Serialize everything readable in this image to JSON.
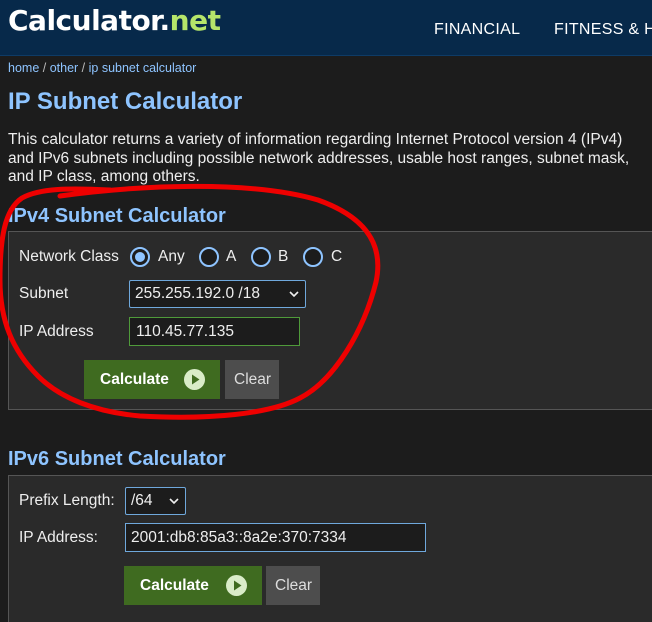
{
  "header": {
    "logo_main": "Calculator",
    "logo_dot": ".",
    "logo_tld": "net",
    "nav": [
      "FINANCIAL",
      "FITNESS & HEALTH"
    ]
  },
  "breadcrumb": {
    "home": "home",
    "sep": " / ",
    "other": "other",
    "current": "ip subnet calculator"
  },
  "page": {
    "title": "IP Subnet Calculator",
    "intro": "This calculator returns a variety of information regarding Internet Protocol version 4 (IPv4) and IPv6 subnets including possible network addresses, usable host ranges, subnet mask, and IP class, among others."
  },
  "ipv4": {
    "title": "IPv4 Subnet Calculator",
    "network_class_label": "Network Class",
    "network_class_options": [
      "Any",
      "A",
      "B",
      "C"
    ],
    "network_class_selected": "Any",
    "subnet_label": "Subnet",
    "subnet_value": "255.255.192.0 /18",
    "ip_label": "IP Address",
    "ip_value": "110.45.77.135",
    "calculate_label": "Calculate",
    "clear_label": "Clear"
  },
  "ipv6": {
    "title": "IPv6 Subnet Calculator",
    "prefix_label": "Prefix Length:",
    "prefix_value": "/64",
    "ip_label": "IP Address:",
    "ip_value": "2001:db8:85a3::8a2e:370:7334",
    "calculate_label": "Calculate",
    "clear_label": "Clear"
  },
  "colors": {
    "header_bg": "#07294a",
    "accent_blue": "#8ec4ff",
    "logo_green": "#b5e56a",
    "button_green": "#3f6b20",
    "annotation_red": "#ee0000"
  },
  "icons": {
    "play": "play-icon",
    "dropdown": "chevron-down-icon"
  }
}
